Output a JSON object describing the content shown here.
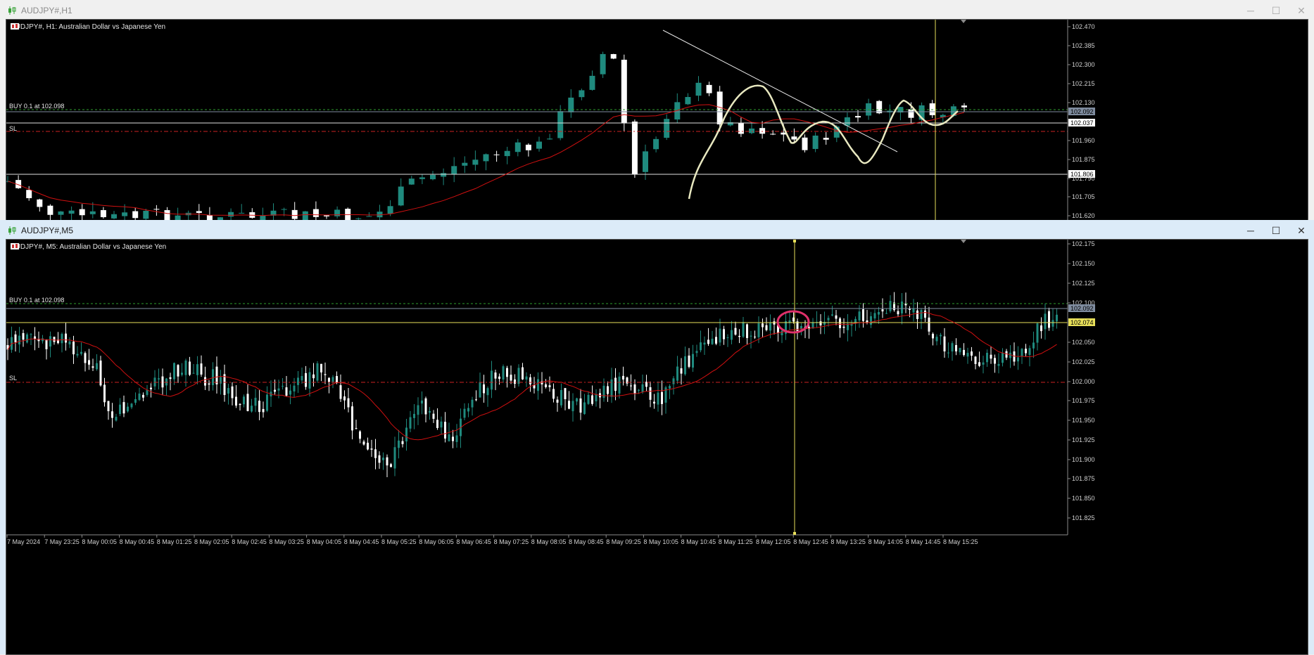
{
  "h1_window": {
    "title": "AUDJPY#,H1",
    "symbol_label": "AUDJPY#, H1:  Australian Dollar vs Japanese Yen",
    "buy_label": "BUY 0.1 at 102.098",
    "sl_label": "SL",
    "price_ticks": [
      "102.470",
      "102.385",
      "102.300",
      "102.215",
      "102.130",
      "101.960",
      "101.875",
      "101.790",
      "101.705",
      "101.620"
    ],
    "price_boxes": [
      {
        "text": "102.092",
        "style": "grey"
      },
      {
        "text": "102.037",
        "style": "white"
      },
      {
        "text": "101.806",
        "style": "white"
      }
    ]
  },
  "m5_window": {
    "title": "AUDJPY#,M5",
    "symbol_label": "AUDJPY#, M5:  Australian Dollar vs Japanese Yen",
    "buy_label": "BUY 0.1 at 102.098",
    "sl_label": "SL",
    "price_ticks": [
      "102.175",
      "102.150",
      "102.125",
      "102.100",
      "102.050",
      "102.025",
      "102.000",
      "101.975",
      "101.950",
      "101.925",
      "101.900",
      "101.875",
      "101.850",
      "101.825"
    ],
    "price_boxes": [
      {
        "text": "102.092",
        "style": "grey"
      },
      {
        "text": "102.074",
        "style": "yellow"
      }
    ],
    "time_ticks": [
      "7 May 2024",
      "7 May 23:25",
      "8 May 00:05",
      "8 May 00:45",
      "8 May 01:25",
      "8 May 02:05",
      "8 May 02:45",
      "8 May 03:25",
      "8 May 04:05",
      "8 May 04:45",
      "8 May 05:25",
      "8 May 06:05",
      "8 May 06:45",
      "8 May 07:25",
      "8 May 08:05",
      "8 May 08:45",
      "8 May 09:25",
      "8 May 10:05",
      "8 May 10:45",
      "8 May 11:25",
      "8 May 12:05",
      "8 May 12:45",
      "8 May 13:25",
      "8 May 14:05",
      "8 May 14:45",
      "8 May 15:25"
    ]
  },
  "window_controls": {
    "minimize": "─",
    "maximize": "☐",
    "close": "✕"
  },
  "colors": {
    "bull": "#1f8a7e",
    "bear": "#ffffff",
    "ma": "#d01010",
    "level_yellow": "#e8e05a",
    "sl": "#cc2222",
    "buy": "#2e9e2e",
    "trend": "#e8e8c0",
    "circle": "#e0306a"
  },
  "icons": {
    "window_icon": "candlestick-icon",
    "symbol_icon": "flag-icon"
  }
}
